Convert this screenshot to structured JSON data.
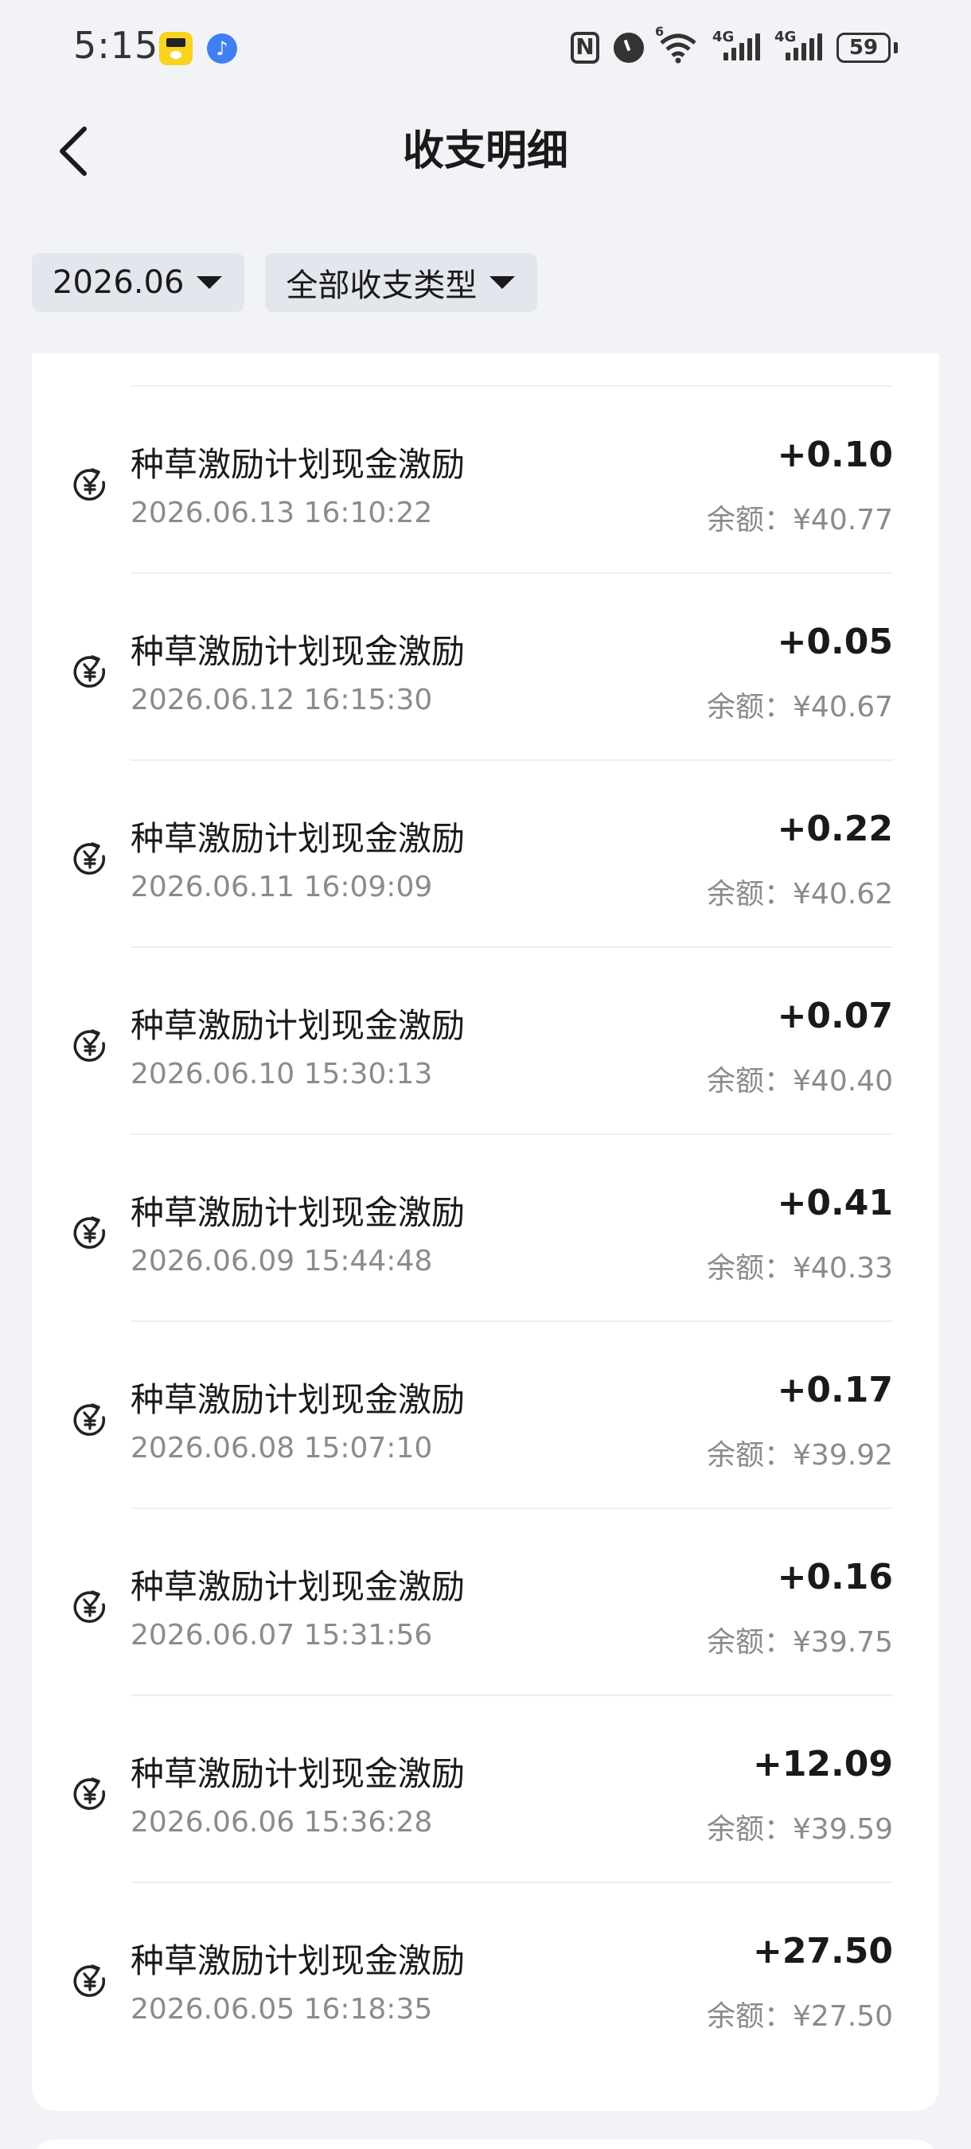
{
  "status_bar": {
    "time": "5:15",
    "network_1": "6",
    "network_2": "4G",
    "network_3": "4G",
    "battery": "59"
  },
  "header": {
    "title": "收支明细"
  },
  "filters": {
    "month": "2026.06",
    "type": "全部收支类型"
  },
  "transactions": [
    {
      "title": "种草激励计划现金激励",
      "time": "2026.06.13 16:10:22",
      "amount": "+0.10",
      "balance": "余额：¥40.77"
    },
    {
      "title": "种草激励计划现金激励",
      "time": "2026.06.12 16:15:30",
      "amount": "+0.05",
      "balance": "余额：¥40.67"
    },
    {
      "title": "种草激励计划现金激励",
      "time": "2026.06.11 16:09:09",
      "amount": "+0.22",
      "balance": "余额：¥40.62"
    },
    {
      "title": "种草激励计划现金激励",
      "time": "2026.06.10 15:30:13",
      "amount": "+0.07",
      "balance": "余额：¥40.40"
    },
    {
      "title": "种草激励计划现金激励",
      "time": "2026.06.09 15:44:48",
      "amount": "+0.41",
      "balance": "余额：¥40.33"
    },
    {
      "title": "种草激励计划现金激励",
      "time": "2026.06.08 15:07:10",
      "amount": "+0.17",
      "balance": "余额：¥39.92"
    },
    {
      "title": "种草激励计划现金激励",
      "time": "2026.06.07 15:31:56",
      "amount": "+0.16",
      "balance": "余额：¥39.75"
    },
    {
      "title": "种草激励计划现金激励",
      "time": "2026.06.06 15:36:28",
      "amount": "+12.09",
      "balance": "余额：¥39.59"
    },
    {
      "title": "种草激励计划现金激励",
      "time": "2026.06.05 16:18:35",
      "amount": "+27.50",
      "balance": "余额：¥27.50"
    }
  ],
  "icons": {
    "back": "back-arrow-icon",
    "transaction": "yuan-refresh-icon"
  },
  "colors": {
    "background": "#f2f3f7",
    "card": "#ffffff",
    "chip": "#e4e6ed",
    "primary_text": "#1a1a1a",
    "secondary_text": "#8a8a8f"
  }
}
